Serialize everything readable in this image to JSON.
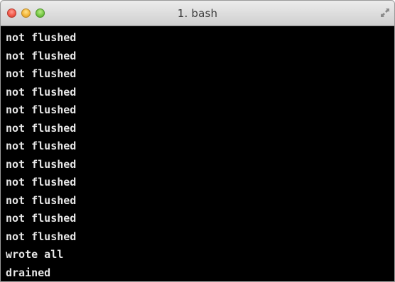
{
  "window": {
    "title": "1. bash"
  },
  "terminal": {
    "lines": [
      "not flushed",
      "not flushed",
      "not flushed",
      "not flushed",
      "not flushed",
      "not flushed",
      "not flushed",
      "not flushed",
      "not flushed",
      "not flushed",
      "not flushed",
      "not flushed",
      "wrote all",
      "drained"
    ]
  },
  "icons": {
    "close": "close-icon",
    "minimize": "minimize-icon",
    "zoom": "zoom-icon",
    "fullscreen": "fullscreen-icon"
  },
  "colors": {
    "terminal_background": "#000000",
    "terminal_text": "#e6e6e6",
    "close": "#f25a4b",
    "minimize": "#f5b83c",
    "zoom": "#79c948"
  }
}
